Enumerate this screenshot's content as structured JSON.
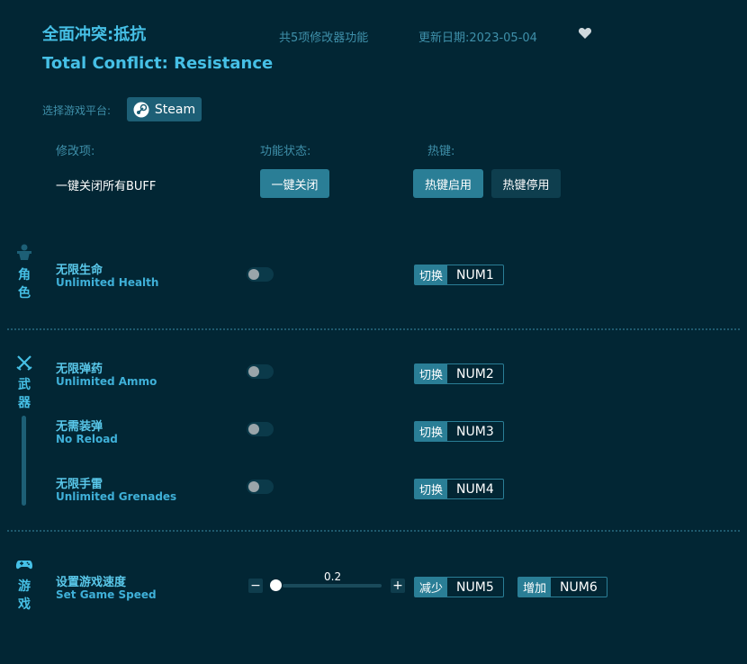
{
  "header": {
    "title_cn": "全面冲突:抵抗",
    "title_en": "Total Conflict: Resistance",
    "feature_count": "共5项修改器功能",
    "update_date": "更新日期:2023-05-04"
  },
  "platform": {
    "label": "选择游戏平台:",
    "steam_label": "Steam"
  },
  "columns": {
    "item": "修改项:",
    "status": "功能状态:",
    "hotkey": "热键:"
  },
  "buff": {
    "label": "一键关闭所有BUFF",
    "close_button": "一键关闭",
    "hotkey_enable": "热键启用",
    "hotkey_disable": "热键停用"
  },
  "categories": {
    "character": "角色",
    "weapon": "武器",
    "game": "游戏"
  },
  "items": [
    {
      "cn": "无限生命",
      "en": "Unlimited Health",
      "action": "切换",
      "key": "NUM1",
      "enabled": false
    },
    {
      "cn": "无限弹药",
      "en": "Unlimited Ammo",
      "action": "切换",
      "key": "NUM2",
      "enabled": false
    },
    {
      "cn": "无需装弹",
      "en": "No Reload",
      "action": "切换",
      "key": "NUM3",
      "enabled": false
    },
    {
      "cn": "无限手雷",
      "en": "Unlimited Grenades",
      "action": "切换",
      "key": "NUM4",
      "enabled": false
    }
  ],
  "speed": {
    "cn": "设置游戏速度",
    "en": "Set Game Speed",
    "value": "0.2",
    "minus": "−",
    "plus": "+",
    "decrease_action": "减少",
    "decrease_key": "NUM5",
    "increase_action": "增加",
    "increase_key": "NUM6"
  },
  "colors": {
    "background": "#022634",
    "accent": "#46c0e6",
    "button": "#2a7e96"
  }
}
